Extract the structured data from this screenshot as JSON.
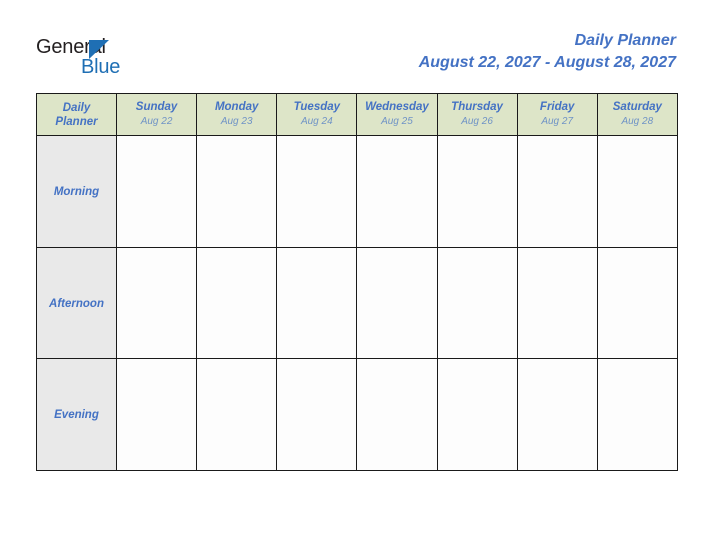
{
  "brand": {
    "word_primary": "General",
    "word_secondary": "Blue",
    "triangle_icon": "triangle-icon",
    "primary_color": "#231f20",
    "secondary_color": "#1f6fb4"
  },
  "header": {
    "title": "Daily Planner",
    "date_range": "August 22, 2027 - August 28, 2027",
    "title_color": "#4472c4"
  },
  "table": {
    "corner_label_line1": "Daily",
    "corner_label_line2": "Planner",
    "header_bg": "#dde5c8",
    "period_bg": "#e9e9e9",
    "border_color": "#1a1a1a",
    "columns": [
      {
        "day": "Sunday",
        "date": "Aug 22"
      },
      {
        "day": "Monday",
        "date": "Aug 23"
      },
      {
        "day": "Tuesday",
        "date": "Aug 24"
      },
      {
        "day": "Wednesday",
        "date": "Aug 25"
      },
      {
        "day": "Thursday",
        "date": "Aug 26"
      },
      {
        "day": "Friday",
        "date": "Aug 27"
      },
      {
        "day": "Saturday",
        "date": "Aug 28"
      }
    ],
    "rows": [
      {
        "period": "Morning",
        "slots": [
          "",
          "",
          "",
          "",
          "",
          "",
          ""
        ]
      },
      {
        "period": "Afternoon",
        "slots": [
          "",
          "",
          "",
          "",
          "",
          "",
          ""
        ]
      },
      {
        "period": "Evening",
        "slots": [
          "",
          "",
          "",
          "",
          "",
          "",
          ""
        ]
      }
    ]
  }
}
